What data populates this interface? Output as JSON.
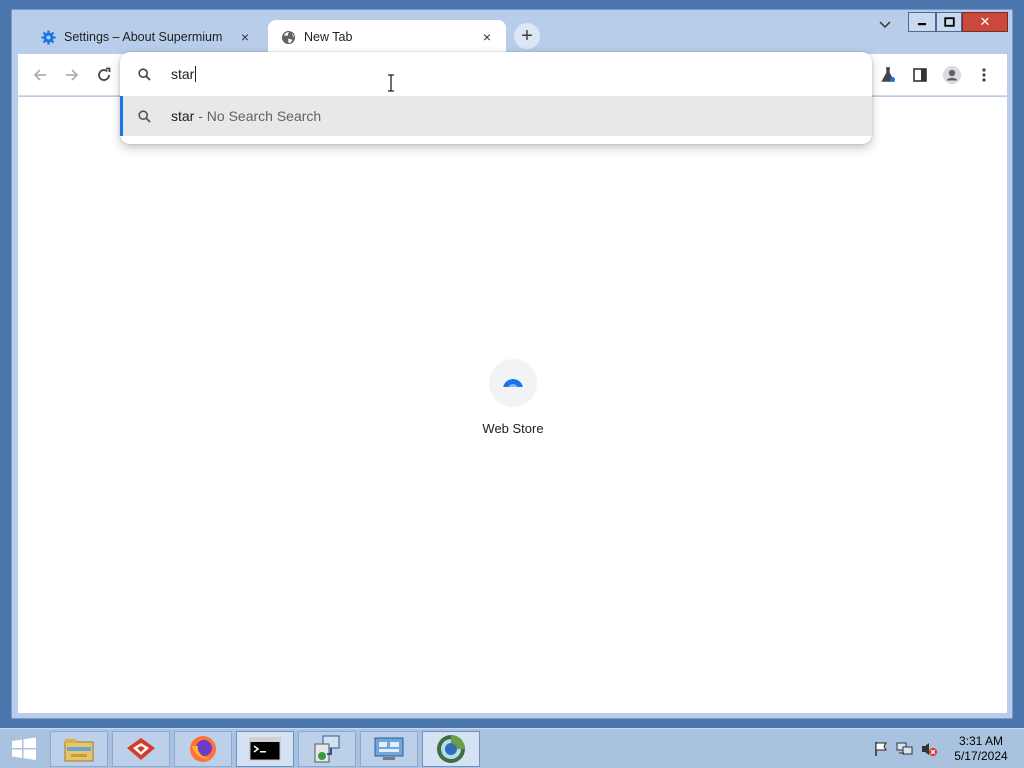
{
  "tabs": [
    {
      "title": "Settings – About Supermium",
      "favicon": "gear-icon",
      "close_label": "×"
    },
    {
      "title": "New Tab",
      "favicon": "globe-icon",
      "close_label": "×"
    }
  ],
  "new_tab_button": "+",
  "window_controls": {
    "close": "✕"
  },
  "omnibox": {
    "input_value": "star",
    "suggestion": {
      "text": "star",
      "description": " - No Search Search"
    }
  },
  "shortcuts": [
    {
      "label": "Web Store",
      "icon": "web-store-icon"
    }
  ],
  "taskbar": {
    "apps": [
      "file-explorer-icon",
      "app-red-logo-icon",
      "firefox-icon",
      "command-prompt-icon",
      "installer-icon",
      "control-panel-icon",
      "supermium-icon"
    ],
    "clock": {
      "time": "3:31 AM",
      "date": "5/17/2024"
    }
  },
  "colors": {
    "accent": "#1a73e8",
    "taskbar": "#a9c2e0",
    "tabstrip": "#b8cdea"
  }
}
